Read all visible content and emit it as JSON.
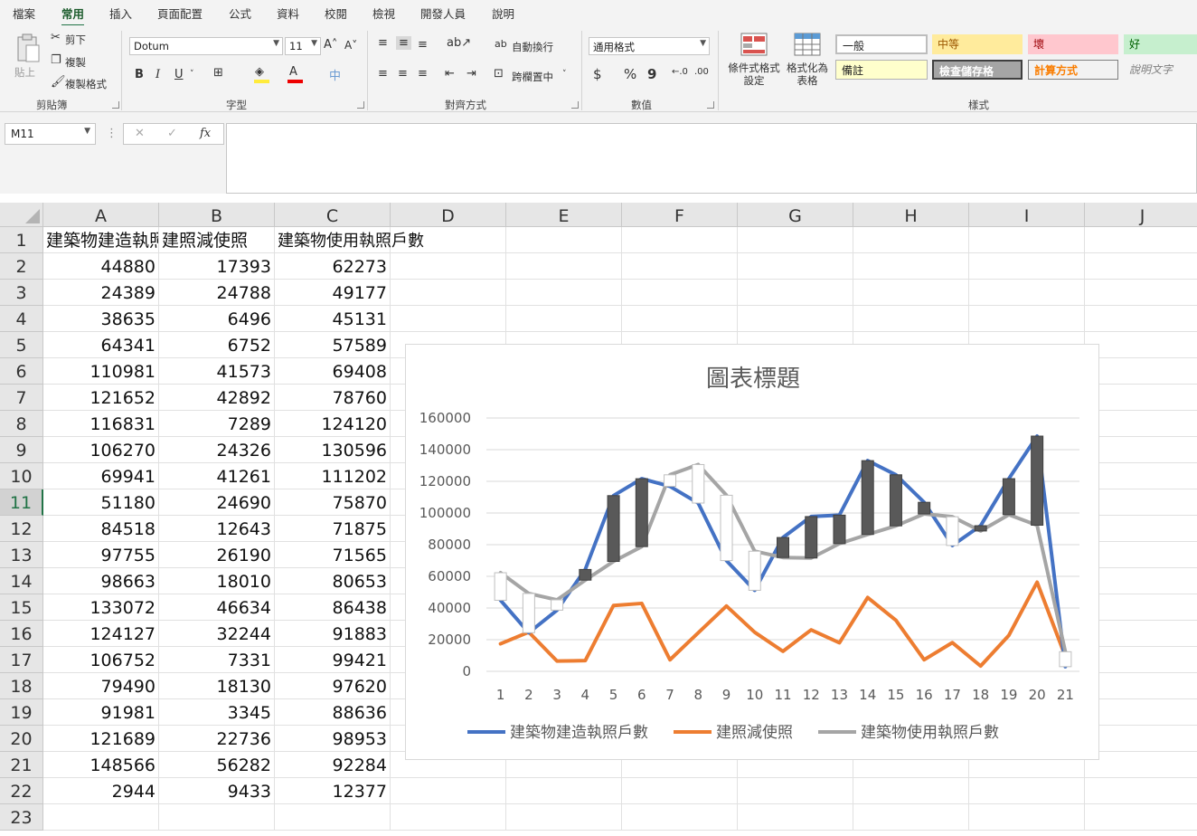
{
  "ribbon": {
    "tabs": [
      "檔案",
      "常用",
      "插入",
      "頁面配置",
      "公式",
      "資料",
      "校閱",
      "檢視",
      "開發人員",
      "說明"
    ],
    "active_tab": "常用",
    "clipboard": {
      "paste": "貼上",
      "cut": "剪下",
      "copy": "複製",
      "format_painter": "複製格式",
      "group": "剪貼簿"
    },
    "font": {
      "name": "Dotum",
      "size": "11",
      "group": "字型",
      "bold": "B",
      "italic": "I",
      "underline": "U"
    },
    "alignment": {
      "wrap": "自動換行",
      "merge": "跨欄置中",
      "group": "對齊方式"
    },
    "number": {
      "format": "通用格式",
      "group": "數值",
      "currency": "$",
      "percent": "%",
      "comma": "9"
    },
    "styles": {
      "conditional": "條件式格式\n設定",
      "format_table": "格式化為\n表格",
      "group": "樣式",
      "cells": [
        "一般",
        "中等",
        "壞",
        "好",
        "備註",
        "檢查儲存格",
        "計算方式",
        "說明文字"
      ]
    }
  },
  "formula_bar": {
    "name_box": "M11",
    "fx": "fx",
    "value": ""
  },
  "columns": [
    "A",
    "B",
    "C",
    "D",
    "E",
    "F",
    "G",
    "H",
    "I",
    "J"
  ],
  "rows": [
    "1",
    "2",
    "3",
    "4",
    "5",
    "6",
    "7",
    "8",
    "9",
    "10",
    "11",
    "12",
    "13",
    "14",
    "15",
    "16",
    "17",
    "18",
    "19",
    "20",
    "21",
    "22",
    "23"
  ],
  "selected_row": "11",
  "headers": [
    "建築物建造執照戶數",
    "建照減使照",
    "建築物使用執照戶數"
  ],
  "table": [
    [
      "44880",
      "17393",
      "62273"
    ],
    [
      "24389",
      "24788",
      "49177"
    ],
    [
      "38635",
      "6496",
      "45131"
    ],
    [
      "64341",
      "6752",
      "57589"
    ],
    [
      "110981",
      "41573",
      "69408"
    ],
    [
      "121652",
      "42892",
      "78760"
    ],
    [
      "116831",
      "7289",
      "124120"
    ],
    [
      "106270",
      "24326",
      "130596"
    ],
    [
      "69941",
      "41261",
      "111202"
    ],
    [
      "51180",
      "24690",
      "75870"
    ],
    [
      "84518",
      "12643",
      "71875"
    ],
    [
      "97755",
      "26190",
      "71565"
    ],
    [
      "98663",
      "18010",
      "80653"
    ],
    [
      "133072",
      "46634",
      "86438"
    ],
    [
      "124127",
      "32244",
      "91883"
    ],
    [
      "106752",
      "7331",
      "99421"
    ],
    [
      "79490",
      "18130",
      "97620"
    ],
    [
      "91981",
      "3345",
      "88636"
    ],
    [
      "121689",
      "22736",
      "98953"
    ],
    [
      "148566",
      "56282",
      "92284"
    ],
    [
      "2944",
      "9433",
      "12377"
    ]
  ],
  "chart_data": {
    "type": "line",
    "title": "圖表標題",
    "x": [
      1,
      2,
      3,
      4,
      5,
      6,
      7,
      8,
      9,
      10,
      11,
      12,
      13,
      14,
      15,
      16,
      17,
      18,
      19,
      20,
      21
    ],
    "ylim": [
      0,
      160000
    ],
    "yticks": [
      0,
      20000,
      40000,
      60000,
      80000,
      100000,
      120000,
      140000,
      160000
    ],
    "grid": true,
    "legend": "bottom",
    "up_down_bars": true,
    "series": [
      {
        "name": "建築物建造執照戶數",
        "color": "#4472c4",
        "values": [
          44880,
          24389,
          38635,
          64341,
          110981,
          121652,
          116831,
          106270,
          69941,
          51180,
          84518,
          97755,
          98663,
          133072,
          124127,
          106752,
          79490,
          91981,
          121689,
          148566,
          2944
        ]
      },
      {
        "name": "建照減使照",
        "color": "#ed7d31",
        "values": [
          17393,
          24788,
          6496,
          6752,
          41573,
          42892,
          7289,
          24326,
          41261,
          24690,
          12643,
          26190,
          18010,
          46634,
          32244,
          7331,
          18130,
          3345,
          22736,
          56282,
          9433
        ]
      },
      {
        "name": "建築物使用執照戶數",
        "color": "#a5a5a5",
        "values": [
          62273,
          49177,
          45131,
          57589,
          69408,
          78760,
          124120,
          130596,
          111202,
          75870,
          71875,
          71565,
          80653,
          86438,
          91883,
          99421,
          97620,
          88636,
          98953,
          92284,
          12377
        ]
      }
    ]
  }
}
